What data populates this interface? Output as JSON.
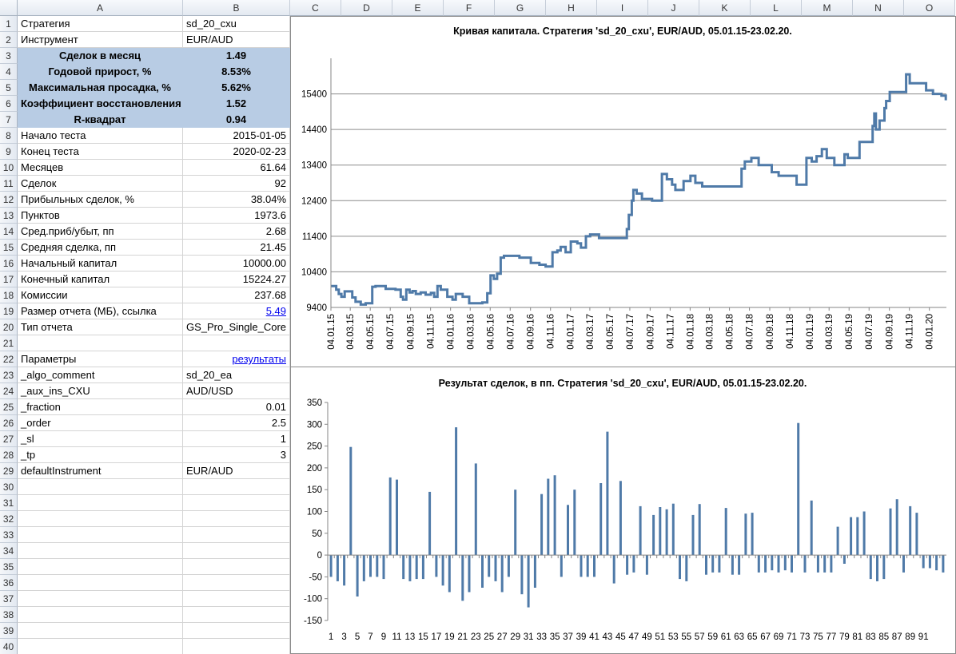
{
  "columns": [
    "A",
    "B",
    "C",
    "D",
    "E",
    "F",
    "G",
    "H",
    "I",
    "J",
    "K",
    "L",
    "M",
    "N",
    "O"
  ],
  "rows": [
    "1",
    "2",
    "3",
    "4",
    "5",
    "6",
    "7",
    "8",
    "9",
    "10",
    "11",
    "12",
    "13",
    "14",
    "15",
    "16",
    "17",
    "18",
    "19",
    "20",
    "21",
    "22",
    "23",
    "24",
    "25",
    "26",
    "27",
    "28",
    "29",
    "30",
    "31",
    "32",
    "33",
    "34",
    "35",
    "36",
    "37",
    "38",
    "39",
    "40"
  ],
  "table": [
    {
      "a": "Стратегия",
      "b": "sd_20_cxu",
      "align": "l",
      "hl": false,
      "link": false
    },
    {
      "a": "Инструмент",
      "b": "EUR/AUD",
      "align": "l",
      "hl": false,
      "link": false
    },
    {
      "a": "Сделок в месяц",
      "b": "1.49",
      "align": "c",
      "hl": true,
      "link": false
    },
    {
      "a": "Годовой прирост, %",
      "b": "8.53%",
      "align": "c",
      "hl": true,
      "link": false
    },
    {
      "a": "Максимальная просадка, %",
      "b": "5.62%",
      "align": "c",
      "hl": true,
      "link": false
    },
    {
      "a": "Коэффициент восстановления",
      "b": "1.52",
      "align": "c",
      "hl": true,
      "link": false
    },
    {
      "a": "R-квадрат",
      "b": "0.94",
      "align": "c",
      "hl": true,
      "link": false
    },
    {
      "a": "Начало теста",
      "b": "2015-01-05",
      "align": "r",
      "hl": false,
      "link": false
    },
    {
      "a": "Конец теста",
      "b": "2020-02-23",
      "align": "r",
      "hl": false,
      "link": false
    },
    {
      "a": "Месяцев",
      "b": "61.64",
      "align": "r",
      "hl": false,
      "link": false
    },
    {
      "a": "Сделок",
      "b": "92",
      "align": "r",
      "hl": false,
      "link": false
    },
    {
      "a": "Прибыльных сделок, %",
      "b": "38.04%",
      "align": "r",
      "hl": false,
      "link": false
    },
    {
      "a": "Пунктов",
      "b": "1973.6",
      "align": "r",
      "hl": false,
      "link": false
    },
    {
      "a": "Сред.приб/убыт, пп",
      "b": "2.68",
      "align": "r",
      "hl": false,
      "link": false
    },
    {
      "a": "Средняя сделка, пп",
      "b": "21.45",
      "align": "r",
      "hl": false,
      "link": false
    },
    {
      "a": "Начальный капитал",
      "b": "10000.00",
      "align": "r",
      "hl": false,
      "link": false
    },
    {
      "a": "Конечный капитал",
      "b": "15224.27",
      "align": "r",
      "hl": false,
      "link": false
    },
    {
      "a": "Комиссии",
      "b": "237.68",
      "align": "r",
      "hl": false,
      "link": false
    },
    {
      "a": "Размер отчета (МБ), ссылка",
      "b": "5.49",
      "align": "r",
      "hl": false,
      "link": true
    },
    {
      "a": "Тип отчета",
      "b": "GS_Pro_Single_Core",
      "align": "l",
      "hl": false,
      "link": false
    },
    {
      "a": "",
      "b": "",
      "align": "l",
      "hl": false,
      "link": false
    },
    {
      "a": "Параметры",
      "b": "результаты",
      "align": "r",
      "hl": false,
      "link": true
    },
    {
      "a": "_algo_comment",
      "b": "sd_20_ea",
      "align": "l",
      "hl": false,
      "link": false
    },
    {
      "a": "_aux_ins_CXU",
      "b": "AUD/USD",
      "align": "l",
      "hl": false,
      "link": false
    },
    {
      "a": "_fraction",
      "b": "0.01",
      "align": "r",
      "hl": false,
      "link": false
    },
    {
      "a": "_order",
      "b": "2.5",
      "align": "r",
      "hl": false,
      "link": false
    },
    {
      "a": "_sl",
      "b": "1",
      "align": "r",
      "hl": false,
      "link": false
    },
    {
      "a": "_tp",
      "b": "3",
      "align": "r",
      "hl": false,
      "link": false
    },
    {
      "a": "defaultInstrument",
      "b": "EUR/AUD",
      "align": "l",
      "hl": false,
      "link": false
    }
  ],
  "colors": {
    "line": "#4f7aa8",
    "bar": "#4f7aa8",
    "highlight": "#b8cce4",
    "link": "#0000ee"
  },
  "chart_data": [
    {
      "type": "line",
      "title": "Кривая капитала. Стратегия 'sd_20_cxu', EUR/AUD, 05.01.15-23.02.20.",
      "ylim": [
        9400,
        16400
      ],
      "yticks": [
        "9400",
        "10400",
        "11400",
        "12400",
        "13400",
        "14400",
        "15400"
      ],
      "xticks": [
        "04.01.15",
        "04.03.15",
        "04.05.15",
        "04.07.15",
        "04.09.15",
        "04.11.15",
        "04.01.16",
        "04.03.16",
        "04.05.16",
        "04.07.16",
        "04.09.16",
        "04.11.16",
        "04.01.17",
        "04.03.17",
        "04.05.17",
        "04.07.17",
        "04.09.17",
        "04.11.17",
        "04.01.18",
        "04.03.18",
        "04.05.18",
        "04.07.18",
        "04.09.18",
        "04.11.18",
        "04.01.19",
        "04.03.19",
        "04.05.19",
        "04.07.19",
        "04.09.19",
        "04.11.19",
        "04.01.20"
      ],
      "xlim": [
        "2015-01-04",
        "2020-02-25"
      ],
      "grid": true,
      "steps": [
        [
          "2015-01-05",
          10000
        ],
        [
          "2015-01-20",
          9900
        ],
        [
          "2015-01-28",
          9780
        ],
        [
          "2015-02-05",
          9700
        ],
        [
          "2015-02-15",
          9850
        ],
        [
          "2015-03-10",
          9680
        ],
        [
          "2015-03-20",
          9560
        ],
        [
          "2015-04-05",
          9480
        ],
        [
          "2015-04-20",
          9520
        ],
        [
          "2015-05-10",
          9980
        ],
        [
          "2015-05-20",
          10000
        ],
        [
          "2015-06-20",
          9920
        ],
        [
          "2015-07-20",
          9900
        ],
        [
          "2015-08-05",
          9700
        ],
        [
          "2015-08-12",
          9620
        ],
        [
          "2015-08-22",
          9900
        ],
        [
          "2015-09-01",
          9820
        ],
        [
          "2015-09-10",
          9860
        ],
        [
          "2015-09-20",
          9780
        ],
        [
          "2015-10-05",
          9820
        ],
        [
          "2015-10-20",
          9760
        ],
        [
          "2015-11-05",
          9810
        ],
        [
          "2015-11-15",
          9700
        ],
        [
          "2015-11-25",
          10000
        ],
        [
          "2015-12-05",
          9900
        ],
        [
          "2015-12-25",
          9700
        ],
        [
          "2016-01-10",
          9620
        ],
        [
          "2016-01-20",
          9780
        ],
        [
          "2016-02-10",
          9700
        ],
        [
          "2016-03-01",
          9520
        ],
        [
          "2016-04-10",
          9540
        ],
        [
          "2016-04-25",
          9800
        ],
        [
          "2016-05-05",
          10300
        ],
        [
          "2016-05-15",
          10200
        ],
        [
          "2016-05-25",
          10350
        ],
        [
          "2016-06-05",
          10800
        ],
        [
          "2016-06-15",
          10850
        ],
        [
          "2016-08-01",
          10800
        ],
        [
          "2016-09-05",
          10650
        ],
        [
          "2016-10-01",
          10600
        ],
        [
          "2016-10-20",
          10550
        ],
        [
          "2016-11-10",
          10950
        ],
        [
          "2016-11-25",
          11000
        ],
        [
          "2016-12-05",
          11100
        ],
        [
          "2016-12-20",
          10950
        ],
        [
          "2017-01-05",
          11250
        ],
        [
          "2017-01-25",
          11200
        ],
        [
          "2017-02-05",
          11080
        ],
        [
          "2017-02-20",
          11400
        ],
        [
          "2017-03-05",
          11450
        ],
        [
          "2017-04-01",
          11350
        ],
        [
          "2017-06-25",
          11600
        ],
        [
          "2017-07-01",
          12000
        ],
        [
          "2017-07-10",
          12400
        ],
        [
          "2017-07-15",
          12700
        ],
        [
          "2017-07-25",
          12600
        ],
        [
          "2017-08-10",
          12450
        ],
        [
          "2017-09-10",
          12400
        ],
        [
          "2017-10-10",
          13150
        ],
        [
          "2017-10-25",
          13000
        ],
        [
          "2017-11-10",
          12850
        ],
        [
          "2017-11-20",
          12700
        ],
        [
          "2017-12-15",
          12950
        ],
        [
          "2018-01-05",
          13100
        ],
        [
          "2018-01-20",
          12900
        ],
        [
          "2018-02-10",
          12800
        ],
        [
          "2018-06-10",
          13300
        ],
        [
          "2018-06-20",
          13500
        ],
        [
          "2018-07-10",
          13600
        ],
        [
          "2018-08-01",
          13400
        ],
        [
          "2018-09-10",
          13200
        ],
        [
          "2018-10-01",
          13100
        ],
        [
          "2018-11-25",
          12850
        ],
        [
          "2018-12-25",
          13600
        ],
        [
          "2019-01-10",
          13500
        ],
        [
          "2019-01-25",
          13650
        ],
        [
          "2019-02-10",
          13850
        ],
        [
          "2019-02-25",
          13600
        ],
        [
          "2019-03-20",
          13400
        ],
        [
          "2019-04-20",
          13700
        ],
        [
          "2019-04-30",
          13600
        ],
        [
          "2019-06-05",
          14050
        ],
        [
          "2019-07-15",
          14500
        ],
        [
          "2019-07-20",
          14850
        ],
        [
          "2019-07-25",
          14400
        ],
        [
          "2019-08-05",
          14650
        ],
        [
          "2019-08-20",
          15000
        ],
        [
          "2019-08-25",
          15200
        ],
        [
          "2019-09-05",
          15450
        ],
        [
          "2019-10-25",
          15950
        ],
        [
          "2019-11-05",
          15700
        ],
        [
          "2019-12-25",
          15500
        ],
        [
          "2020-01-15",
          15400
        ],
        [
          "2020-02-10",
          15350
        ],
        [
          "2020-02-23",
          15220
        ]
      ]
    },
    {
      "type": "bar",
      "title": "Результат сделок, в пп. Стратегия 'sd_20_cxu', EUR/AUD, 05.01.15-23.02.20.",
      "ylim": [
        -150,
        350
      ],
      "yticks": [
        "-150",
        "-100",
        "-50",
        "0",
        "50",
        "100",
        "150",
        "200",
        "250",
        "300",
        "350"
      ],
      "xticks": [
        "1",
        "3",
        "5",
        "7",
        "9",
        "11",
        "13",
        "15",
        "17",
        "19",
        "21",
        "23",
        "25",
        "27",
        "29",
        "31",
        "33",
        "35",
        "37",
        "39",
        "41",
        "43",
        "45",
        "47",
        "49",
        "51",
        "53",
        "55",
        "57",
        "59",
        "61",
        "63",
        "65",
        "67",
        "69",
        "71",
        "73",
        "75",
        "77",
        "79",
        "81",
        "83",
        "85",
        "87",
        "89",
        "91"
      ],
      "grid": false,
      "values": [
        -50,
        -60,
        -70,
        248,
        -95,
        -60,
        -50,
        -50,
        -55,
        178,
        173,
        -55,
        -60,
        -55,
        -55,
        145,
        -50,
        -70,
        -85,
        293,
        -105,
        -85,
        210,
        -75,
        -50,
        -60,
        -85,
        -50,
        150,
        -90,
        -120,
        -75,
        140,
        175,
        183,
        -50,
        115,
        150,
        -50,
        -50,
        -50,
        165,
        283,
        -65,
        170,
        -45,
        -40,
        112,
        -45,
        92,
        110,
        105,
        118,
        -55,
        -60,
        92,
        117,
        -45,
        -40,
        -40,
        108,
        -45,
        -45,
        95,
        97,
        -40,
        -40,
        -35,
        -40,
        -35,
        -40,
        303,
        -40,
        125,
        -40,
        -40,
        -40,
        65,
        -20,
        87,
        87,
        100,
        -55,
        -60,
        -55,
        107,
        128,
        -40,
        112,
        97,
        -30,
        -30,
        -35,
        -40
      ]
    }
  ]
}
